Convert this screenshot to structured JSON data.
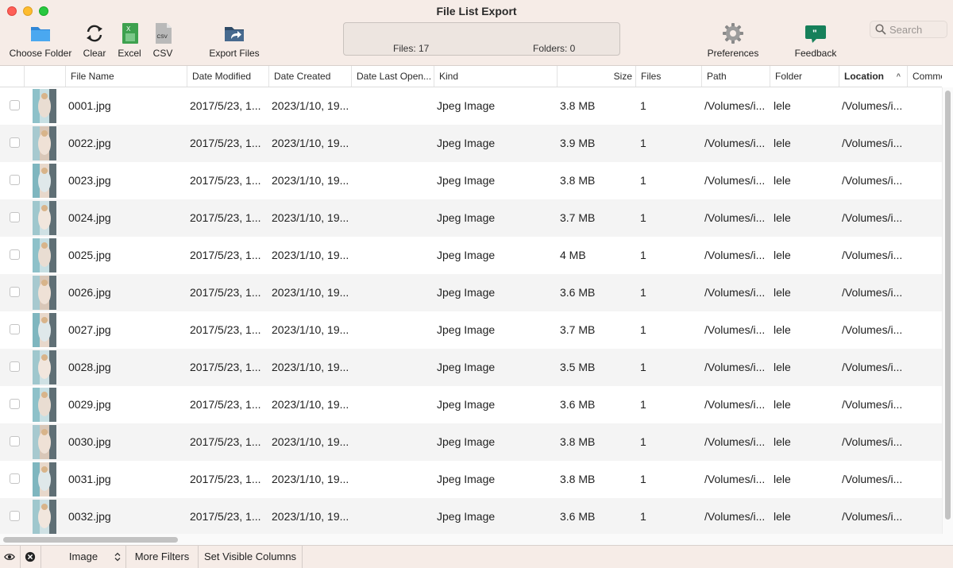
{
  "window": {
    "title": "File List Export"
  },
  "toolbar": {
    "choose_folder": "Choose Folder",
    "clear": "Clear",
    "excel": "Excel",
    "excel_icon_text": "X",
    "csv": "CSV",
    "csv_icon_text": "CSV",
    "export_files": "Export Files",
    "preferences": "Preferences",
    "feedback": "Feedback",
    "feedback_icon_text": "\"",
    "search_placeholder": "Search"
  },
  "status": {
    "files": "Files: 17",
    "folders": "Folders: 0"
  },
  "columns": [
    "File Name",
    "Date Modified",
    "Date Created",
    "Date Last Open...",
    "Kind",
    "Size",
    "Files",
    "Path",
    "Folder",
    "Location",
    "Comme"
  ],
  "sort": {
    "column": "Location",
    "direction": "ascending",
    "indicator": "^"
  },
  "rows": [
    {
      "name": "0001.jpg",
      "modified": "2017/5/23, 1...",
      "created": "2023/1/10, 19...",
      "opened": "",
      "kind": "Jpeg Image",
      "size": "3.8 MB",
      "files": "1",
      "path": "/Volumes/i...",
      "folder": "lele",
      "location": "/Volumes/i..."
    },
    {
      "name": "0022.jpg",
      "modified": "2017/5/23, 1...",
      "created": "2023/1/10, 19...",
      "opened": "",
      "kind": "Jpeg Image",
      "size": "3.9 MB",
      "files": "1",
      "path": "/Volumes/i...",
      "folder": "lele",
      "location": "/Volumes/i..."
    },
    {
      "name": "0023.jpg",
      "modified": "2017/5/23, 1...",
      "created": "2023/1/10, 19...",
      "opened": "",
      "kind": "Jpeg Image",
      "size": "3.8 MB",
      "files": "1",
      "path": "/Volumes/i...",
      "folder": "lele",
      "location": "/Volumes/i..."
    },
    {
      "name": "0024.jpg",
      "modified": "2017/5/23, 1...",
      "created": "2023/1/10, 19...",
      "opened": "",
      "kind": "Jpeg Image",
      "size": "3.7 MB",
      "files": "1",
      "path": "/Volumes/i...",
      "folder": "lele",
      "location": "/Volumes/i..."
    },
    {
      "name": "0025.jpg",
      "modified": "2017/5/23, 1...",
      "created": "2023/1/10, 19...",
      "opened": "",
      "kind": "Jpeg Image",
      "size": "4 MB",
      "files": "1",
      "path": "/Volumes/i...",
      "folder": "lele",
      "location": "/Volumes/i..."
    },
    {
      "name": "0026.jpg",
      "modified": "2017/5/23, 1...",
      "created": "2023/1/10, 19...",
      "opened": "",
      "kind": "Jpeg Image",
      "size": "3.6 MB",
      "files": "1",
      "path": "/Volumes/i...",
      "folder": "lele",
      "location": "/Volumes/i..."
    },
    {
      "name": "0027.jpg",
      "modified": "2017/5/23, 1...",
      "created": "2023/1/10, 19...",
      "opened": "",
      "kind": "Jpeg Image",
      "size": "3.7 MB",
      "files": "1",
      "path": "/Volumes/i...",
      "folder": "lele",
      "location": "/Volumes/i..."
    },
    {
      "name": "0028.jpg",
      "modified": "2017/5/23, 1...",
      "created": "2023/1/10, 19...",
      "opened": "",
      "kind": "Jpeg Image",
      "size": "3.5 MB",
      "files": "1",
      "path": "/Volumes/i...",
      "folder": "lele",
      "location": "/Volumes/i..."
    },
    {
      "name": "0029.jpg",
      "modified": "2017/5/23, 1...",
      "created": "2023/1/10, 19...",
      "opened": "",
      "kind": "Jpeg Image",
      "size": "3.6 MB",
      "files": "1",
      "path": "/Volumes/i...",
      "folder": "lele",
      "location": "/Volumes/i..."
    },
    {
      "name": "0030.jpg",
      "modified": "2017/5/23, 1...",
      "created": "2023/1/10, 19...",
      "opened": "",
      "kind": "Jpeg Image",
      "size": "3.8 MB",
      "files": "1",
      "path": "/Volumes/i...",
      "folder": "lele",
      "location": "/Volumes/i..."
    },
    {
      "name": "0031.jpg",
      "modified": "2017/5/23, 1...",
      "created": "2023/1/10, 19...",
      "opened": "",
      "kind": "Jpeg Image",
      "size": "3.8 MB",
      "files": "1",
      "path": "/Volumes/i...",
      "folder": "lele",
      "location": "/Volumes/i..."
    },
    {
      "name": "0032.jpg",
      "modified": "2017/5/23, 1...",
      "created": "2023/1/10, 19...",
      "opened": "",
      "kind": "Jpeg Image",
      "size": "3.6 MB",
      "files": "1",
      "path": "/Volumes/i...",
      "folder": "lele",
      "location": "/Volumes/i..."
    }
  ],
  "bottombar": {
    "filter_type": "Image",
    "more_filters": "More Filters",
    "set_visible_columns": "Set Visible Columns"
  },
  "icons": {
    "choose_folder": "folder-icon",
    "clear": "refresh-icon",
    "excel": "excel-icon",
    "csv": "csv-file-icon",
    "export_files": "export-folder-icon",
    "preferences": "gear-icon",
    "feedback": "feedback-bubble-icon",
    "search": "search-icon",
    "visibility": "eye-icon",
    "clear_filter": "close-circle-icon",
    "row_thumbnail": "image-thumbnail-icon"
  },
  "colors": {
    "toolbar_bg": "#f6ece7",
    "row_alt": "#f4f4f4",
    "folder_blue": "#3d9be9",
    "excel_green": "#2f8f3e",
    "feedback_green": "#16805a"
  }
}
